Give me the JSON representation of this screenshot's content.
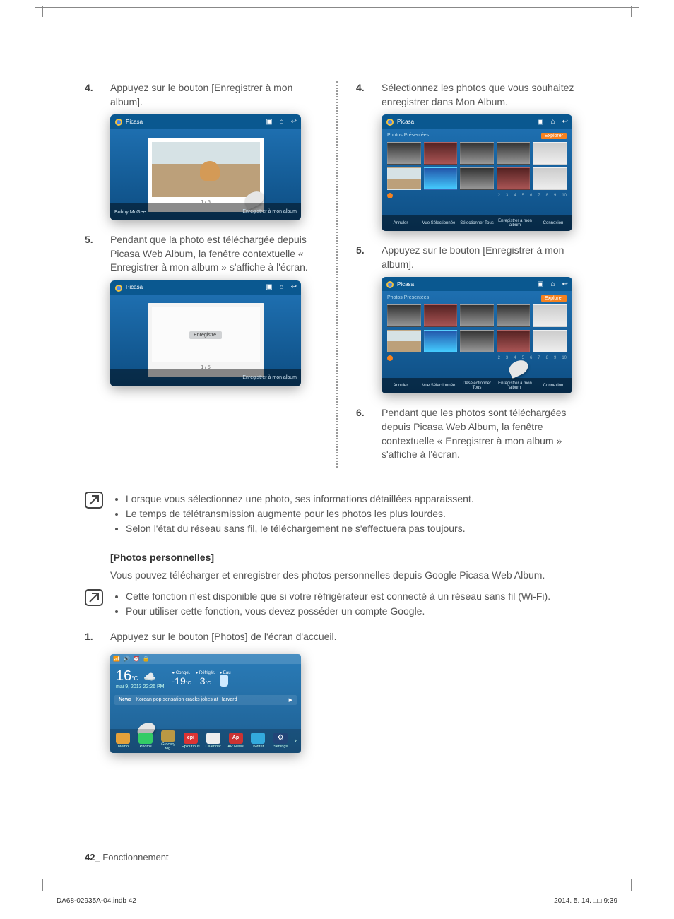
{
  "leftCol": {
    "step4_num": "4.",
    "step4_text": "Appuyez sur le bouton [Enregistrer à mon album].",
    "step5_num": "5.",
    "step5_text": "Pendant que la photo est téléchargée depuis Picasa Web Album, la fenêtre contextuelle « Enregistrer à mon album » s'affiche à l'écran."
  },
  "rightCol": {
    "step4_num": "4.",
    "step4_text": "Sélectionnez les photos que vous souhaitez enregistrer dans Mon Album.",
    "step5_num": "5.",
    "step5_text": "Appuyez sur le bouton [Enregistrer à mon album].",
    "step6_num": "6.",
    "step6_text": "Pendant que les photos sont téléchargées depuis Picasa Web Album, la fenêtre contextuelle « Enregistrer à mon album » s'affiche à l'écran."
  },
  "screenshot1": {
    "title": "Picasa",
    "footer_left": "Bobby McGee",
    "footer_right": "Enregistrer à mon album",
    "caption": "1 / 5"
  },
  "screenshot2": {
    "title": "Picasa",
    "popup": "Enregistré.",
    "caption": "1 / 5",
    "footer_right": "Enregistrer à mon album"
  },
  "gridShot": {
    "title": "Picasa",
    "subbar": "Photos Présentées",
    "explore": "Explorer",
    "pager": [
      "2",
      "3",
      "4",
      "5",
      "6",
      "7",
      "8",
      "9",
      "10"
    ],
    "footerA": {
      "b1": "Annuler",
      "b2": "Vue Sélectionnée",
      "b3": "Sélectionner Tous",
      "b4": "Enregistrer à mon album",
      "b5": "Connexion"
    },
    "footerB": {
      "b1": "Annuler",
      "b2": "Vue Sélectionnée",
      "b3": "Désélectionner Tous",
      "b4": "Enregistrer à mon album",
      "b5": "Connexion"
    }
  },
  "notes1": {
    "b1": "Lorsque vous sélectionnez une photo, ses informations détaillées apparaissent.",
    "b2": "Le temps de télétransmission augmente pour les photos les plus lourdes.",
    "b3": "Selon l'état du réseau sans fil, le téléchargement ne s'effectuera pas toujours."
  },
  "section": {
    "heading": "[Photos personnelles]",
    "sub": "Vous pouvez télécharger et enregistrer des photos personnelles depuis Google Picasa Web Album."
  },
  "notes2": {
    "b1": "Cette fonction n'est disponible que si votre réfrigérateur est connecté à un réseau sans fil (Wi-Fi).",
    "b2": "Pour utiliser cette fonction, vous devez posséder un compte Google."
  },
  "step1": {
    "num": "1.",
    "text": "Appuyez sur le bouton [Photos] de l'écran d'accueil."
  },
  "home": {
    "temp_ext": "16",
    "temp_unit": "°C",
    "date": "mai 9, 2013 22:26 PM",
    "congel_label": "Congel.",
    "congel": "-19",
    "refrige_label": "Réfrigér.",
    "refrige": "3",
    "eau_label": "Eau",
    "news_label": "News",
    "news_text": "Korean pop sensation cracks jokes at Harvard",
    "apps": {
      "memo": "Memo",
      "photos": "Photos",
      "grocery": "Grocery Mg.",
      "epicurious": "Epicurious",
      "calendar": "Calendar",
      "apnews": "AP News",
      "twitter": "Twitter",
      "settings": "Settings"
    }
  },
  "footer": {
    "page": "42",
    "label": "_ Fonctionnement"
  },
  "docmeta": {
    "file": "DA68-02935A-04.indb   42",
    "time": "2014. 5. 14.   □□ 9:39"
  }
}
